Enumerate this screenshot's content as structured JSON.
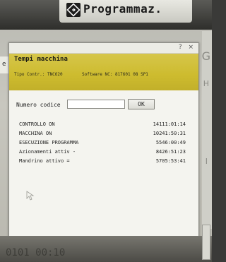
{
  "top_bar": {
    "mode_label": "Programmaz."
  },
  "dialog": {
    "title": "Tempi macchina",
    "control_type": "Tipo Contr.:  TNC620",
    "software_nc": "Software NC: 817601 08 SP1",
    "code_label": "Numero codice",
    "code_value": "",
    "ok_label": "OK",
    "rows": [
      {
        "label": "CONTROLLO ON",
        "value": "14111:01:14"
      },
      {
        "label": "MACCHINA ON",
        "value": "10241:50:31"
      },
      {
        "label": "ESECUZIONE PROGRAMMA",
        "value": "5546:00:49"
      },
      {
        "label": "Azionamenti attiv -",
        "value": "8426:51:23"
      },
      {
        "label": "Mandrino attivo =",
        "value": "5705:53:41"
      }
    ]
  },
  "side": {
    "left_tab": "e",
    "right_letters": [
      "G",
      "H",
      "I"
    ]
  },
  "bottom": {
    "text": "0101 00:10"
  },
  "colors": {
    "header_band": "#cdbb2e",
    "dialog_bg": "#f4f4ef",
    "top_bar": "#2e2e2b"
  },
  "icons": [
    "program-mode-icon",
    "window-controls",
    "mouse-cursor-icon"
  ]
}
